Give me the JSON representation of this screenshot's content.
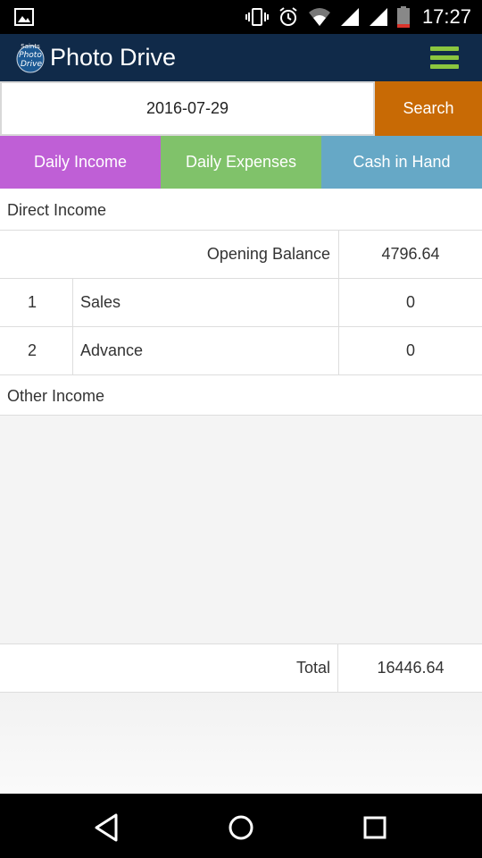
{
  "status_bar": {
    "time": "17:27"
  },
  "app": {
    "title": "Photo Drive",
    "logo_text": "Saints Photo Drive"
  },
  "search": {
    "date_value": "2016-07-29",
    "button_label": "Search"
  },
  "tabs": [
    {
      "label": "Daily Income",
      "color": "#bf5fd6"
    },
    {
      "label": "Daily Expenses",
      "color": "#80c26a"
    },
    {
      "label": "Cash in Hand",
      "color": "#66a8c6"
    }
  ],
  "direct_income": {
    "heading": "Direct Income",
    "opening_balance_label": "Opening Balance",
    "opening_balance_value": "4796.64",
    "rows": [
      {
        "no": "1",
        "name": "Sales",
        "amount": "0"
      },
      {
        "no": "2",
        "name": "Advance",
        "amount": "0"
      }
    ]
  },
  "other_income": {
    "heading": "Other Income"
  },
  "total": {
    "label": "Total",
    "value": "16446.64"
  },
  "colors": {
    "appbar": "#102a49",
    "accent_menu": "#8bc63f",
    "search_button": "#c86a05"
  }
}
